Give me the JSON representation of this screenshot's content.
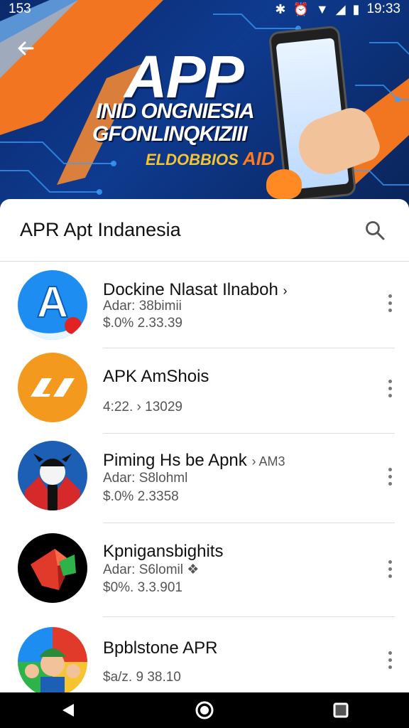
{
  "status_bar": {
    "left": "153",
    "time": "19:33"
  },
  "hero": {
    "title": "APP",
    "subtitle1": "INID ONGNIESIA",
    "subtitle2": "GFONLINQKIZIII",
    "tag": "ELDOBBIOS",
    "tag_accent": "AID"
  },
  "search": {
    "title": "APR Apt Indanesia"
  },
  "apps": [
    {
      "name": "Dockine Nlasat Ilnaboh",
      "suffix": "›",
      "meta1": "Adar: 38bimii",
      "meta2": "$.0%   2.33.39"
    },
    {
      "name": "APK AmShois",
      "suffix": "",
      "meta1": "",
      "meta2": "4:22.  › 13029"
    },
    {
      "name": "Piming Hs be Apnk",
      "suffix": "› AM3",
      "meta1": "Adar: S8lohml",
      "meta2": "$.0%   2.3358"
    },
    {
      "name": "Kpnigansbighits",
      "suffix": "",
      "meta1": "Adar: S6lomil ❖",
      "meta2": "$0%.  3.3.901"
    },
    {
      "name": "Bpblstone APR",
      "suffix": "",
      "meta1": "",
      "meta2": "$a/z.  9 38.10"
    }
  ],
  "icons": {
    "back": "arrow-left-icon",
    "search": "magnifier-icon",
    "more": "vertical-dots-icon",
    "nav": [
      "triangle-back-icon",
      "circle-home-icon",
      "square-recents-icon"
    ]
  },
  "colors": {
    "hero_bg": "#0e3a8f",
    "accent_orange": "#ff7a1c",
    "accent_yellow": "#f6c431"
  }
}
